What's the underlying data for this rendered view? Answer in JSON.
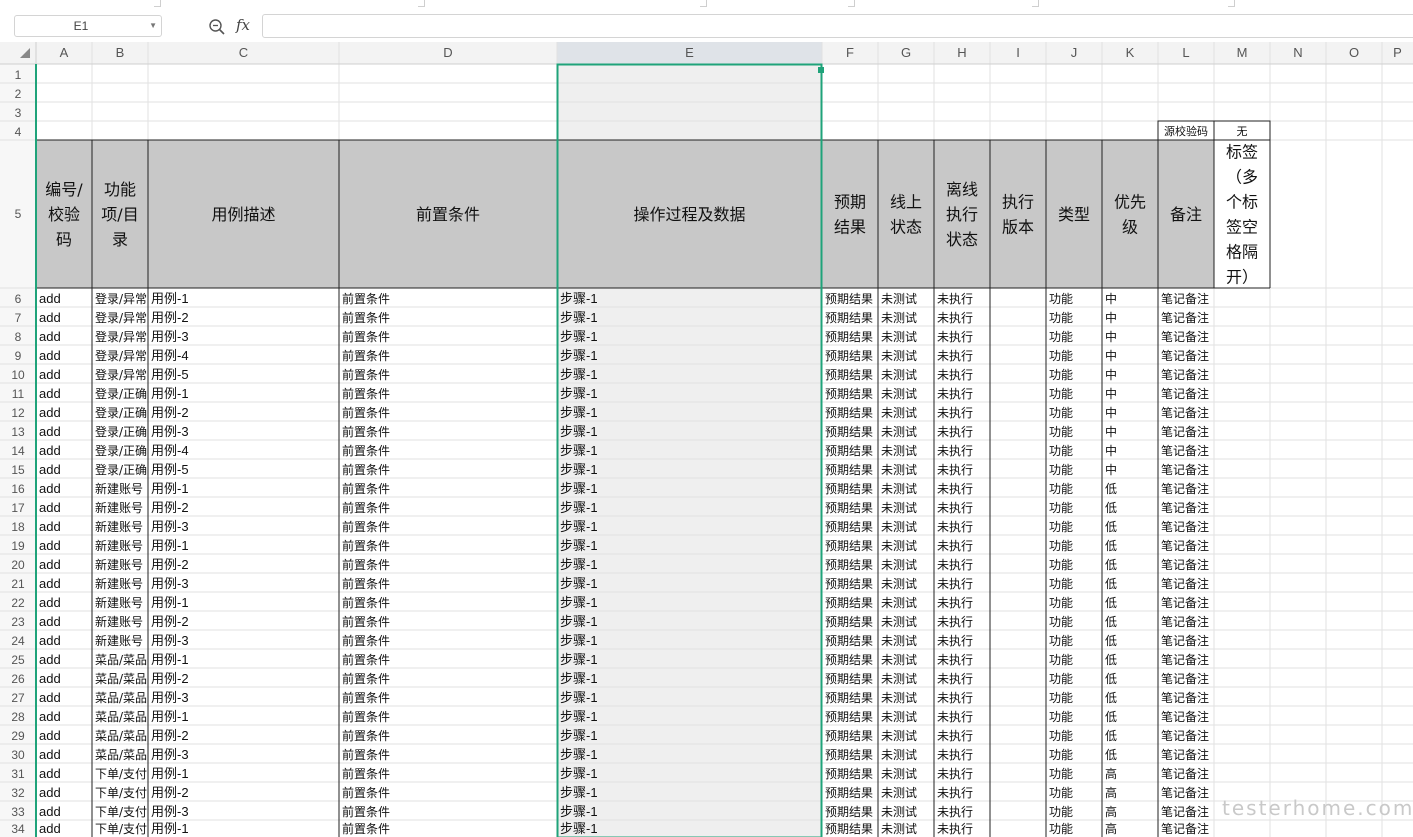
{
  "toolbar": {
    "name_box_value": "E1",
    "fx_label": "fx",
    "formula_value": ""
  },
  "columns": [
    "A",
    "B",
    "C",
    "D",
    "E",
    "F",
    "G",
    "H",
    "I",
    "J",
    "K",
    "L",
    "M",
    "N",
    "O",
    "P"
  ],
  "rows": [
    "1",
    "2",
    "3",
    "4",
    "5",
    "6",
    "7",
    "8",
    "9",
    "10",
    "11",
    "12",
    "13",
    "14",
    "15",
    "16",
    "17",
    "18",
    "19",
    "20",
    "21",
    "22",
    "23",
    "24",
    "25",
    "26",
    "27",
    "28",
    "29",
    "30",
    "31",
    "32",
    "33",
    "34"
  ],
  "selected_column": "E",
  "colors": {
    "header_fill": "#c8c8c8",
    "selection": "#1fa37a",
    "selected_col_fill": "#efefef"
  },
  "meta_cells": {
    "label": "源校验码",
    "value": "无"
  },
  "headers": [
    [
      "编号/",
      "校验",
      "码"
    ],
    [
      "功能",
      "项/目",
      "录"
    ],
    [
      "用例描述"
    ],
    [
      "前置条件"
    ],
    [
      "操作过程及数据"
    ],
    [
      "预期",
      "结果"
    ],
    [
      "线上",
      "状态"
    ],
    [
      "离线",
      "执行",
      "状态"
    ],
    [
      "执行",
      "版本"
    ],
    [
      "类型"
    ],
    [
      "优先",
      "级"
    ],
    [
      "备注"
    ],
    [
      "标签",
      "（多",
      "个标",
      "签空",
      "格隔",
      "开）"
    ]
  ],
  "data_rows": [
    [
      "add",
      "登录/异常",
      "用例-1",
      "前置条件",
      "步骤-1",
      "预期结果",
      "未测试",
      "未执行",
      "",
      "功能",
      "中",
      "笔记备注"
    ],
    [
      "add",
      "登录/异常",
      "用例-2",
      "前置条件",
      "步骤-1",
      "预期结果",
      "未测试",
      "未执行",
      "",
      "功能",
      "中",
      "笔记备注"
    ],
    [
      "add",
      "登录/异常",
      "用例-3",
      "前置条件",
      "步骤-1",
      "预期结果",
      "未测试",
      "未执行",
      "",
      "功能",
      "中",
      "笔记备注"
    ],
    [
      "add",
      "登录/异常",
      "用例-4",
      "前置条件",
      "步骤-1",
      "预期结果",
      "未测试",
      "未执行",
      "",
      "功能",
      "中",
      "笔记备注"
    ],
    [
      "add",
      "登录/异常",
      "用例-5",
      "前置条件",
      "步骤-1",
      "预期结果",
      "未测试",
      "未执行",
      "",
      "功能",
      "中",
      "笔记备注"
    ],
    [
      "add",
      "登录/正确",
      "用例-1",
      "前置条件",
      "步骤-1",
      "预期结果",
      "未测试",
      "未执行",
      "",
      "功能",
      "中",
      "笔记备注"
    ],
    [
      "add",
      "登录/正确",
      "用例-2",
      "前置条件",
      "步骤-1",
      "预期结果",
      "未测试",
      "未执行",
      "",
      "功能",
      "中",
      "笔记备注"
    ],
    [
      "add",
      "登录/正确",
      "用例-3",
      "前置条件",
      "步骤-1",
      "预期结果",
      "未测试",
      "未执行",
      "",
      "功能",
      "中",
      "笔记备注"
    ],
    [
      "add",
      "登录/正确",
      "用例-4",
      "前置条件",
      "步骤-1",
      "预期结果",
      "未测试",
      "未执行",
      "",
      "功能",
      "中",
      "笔记备注"
    ],
    [
      "add",
      "登录/正确",
      "用例-5",
      "前置条件",
      "步骤-1",
      "预期结果",
      "未测试",
      "未执行",
      "",
      "功能",
      "中",
      "笔记备注"
    ],
    [
      "add",
      "新建账号",
      "用例-1",
      "前置条件",
      "步骤-1",
      "预期结果",
      "未测试",
      "未执行",
      "",
      "功能",
      "低",
      "笔记备注"
    ],
    [
      "add",
      "新建账号",
      "用例-2",
      "前置条件",
      "步骤-1",
      "预期结果",
      "未测试",
      "未执行",
      "",
      "功能",
      "低",
      "笔记备注"
    ],
    [
      "add",
      "新建账号",
      "用例-3",
      "前置条件",
      "步骤-1",
      "预期结果",
      "未测试",
      "未执行",
      "",
      "功能",
      "低",
      "笔记备注"
    ],
    [
      "add",
      "新建账号",
      "用例-1",
      "前置条件",
      "步骤-1",
      "预期结果",
      "未测试",
      "未执行",
      "",
      "功能",
      "低",
      "笔记备注"
    ],
    [
      "add",
      "新建账号",
      "用例-2",
      "前置条件",
      "步骤-1",
      "预期结果",
      "未测试",
      "未执行",
      "",
      "功能",
      "低",
      "笔记备注"
    ],
    [
      "add",
      "新建账号",
      "用例-3",
      "前置条件",
      "步骤-1",
      "预期结果",
      "未测试",
      "未执行",
      "",
      "功能",
      "低",
      "笔记备注"
    ],
    [
      "add",
      "新建账号",
      "用例-1",
      "前置条件",
      "步骤-1",
      "预期结果",
      "未测试",
      "未执行",
      "",
      "功能",
      "低",
      "笔记备注"
    ],
    [
      "add",
      "新建账号",
      "用例-2",
      "前置条件",
      "步骤-1",
      "预期结果",
      "未测试",
      "未执行",
      "",
      "功能",
      "低",
      "笔记备注"
    ],
    [
      "add",
      "新建账号",
      "用例-3",
      "前置条件",
      "步骤-1",
      "预期结果",
      "未测试",
      "未执行",
      "",
      "功能",
      "低",
      "笔记备注"
    ],
    [
      "add",
      "菜品/菜品",
      "用例-1",
      "前置条件",
      "步骤-1",
      "预期结果",
      "未测试",
      "未执行",
      "",
      "功能",
      "低",
      "笔记备注"
    ],
    [
      "add",
      "菜品/菜品",
      "用例-2",
      "前置条件",
      "步骤-1",
      "预期结果",
      "未测试",
      "未执行",
      "",
      "功能",
      "低",
      "笔记备注"
    ],
    [
      "add",
      "菜品/菜品",
      "用例-3",
      "前置条件",
      "步骤-1",
      "预期结果",
      "未测试",
      "未执行",
      "",
      "功能",
      "低",
      "笔记备注"
    ],
    [
      "add",
      "菜品/菜品",
      "用例-1",
      "前置条件",
      "步骤-1",
      "预期结果",
      "未测试",
      "未执行",
      "",
      "功能",
      "低",
      "笔记备注"
    ],
    [
      "add",
      "菜品/菜品",
      "用例-2",
      "前置条件",
      "步骤-1",
      "预期结果",
      "未测试",
      "未执行",
      "",
      "功能",
      "低",
      "笔记备注"
    ],
    [
      "add",
      "菜品/菜品",
      "用例-3",
      "前置条件",
      "步骤-1",
      "预期结果",
      "未测试",
      "未执行",
      "",
      "功能",
      "低",
      "笔记备注"
    ],
    [
      "add",
      "下单/支付",
      "用例-1",
      "前置条件",
      "步骤-1",
      "预期结果",
      "未测试",
      "未执行",
      "",
      "功能",
      "高",
      "笔记备注"
    ],
    [
      "add",
      "下单/支付",
      "用例-2",
      "前置条件",
      "步骤-1",
      "预期结果",
      "未测试",
      "未执行",
      "",
      "功能",
      "高",
      "笔记备注"
    ],
    [
      "add",
      "下单/支付",
      "用例-3",
      "前置条件",
      "步骤-1",
      "预期结果",
      "未测试",
      "未执行",
      "",
      "功能",
      "高",
      "笔记备注"
    ],
    [
      "add",
      "下单/支付",
      "用例-1",
      "前置条件",
      "步骤-1",
      "预期结果",
      "未测试",
      "未执行",
      "",
      "功能",
      "高",
      "笔记备注"
    ]
  ],
  "watermark": "testerhome.com"
}
